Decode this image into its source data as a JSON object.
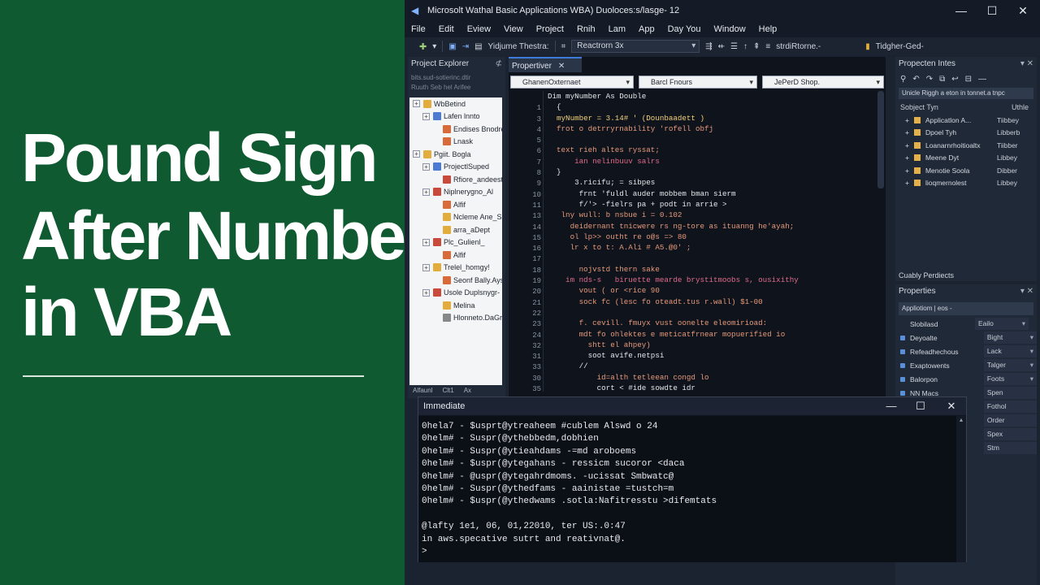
{
  "banner": {
    "line1": "Pound Sign",
    "line2": "After Numbers",
    "line3": "in VBA"
  },
  "window": {
    "title": "Microsolt Wathal Basic Applications WBA) Duoloces:s/lasge- 12",
    "min": "—",
    "max": "☐",
    "close": "✕"
  },
  "menu": [
    "File",
    "Edit",
    "Eview",
    "View",
    "Project",
    "Rnih",
    "Lam",
    "App",
    "Day You",
    "Window",
    "Help"
  ],
  "toolbar": {
    "project_label": "Yidjume Thestra:",
    "combo": "Reactrorn 3x",
    "right_label": "strdiRtorne.-",
    "far_right": "Tidgher-Ged-"
  },
  "project_explorer": {
    "title": "Project Explorer",
    "path1": "bits.sud-sotierinc.dtir",
    "path2": "Ruuth Seb   hel Arifee",
    "items": [
      {
        "label": "WbBetind",
        "indent": 0,
        "exp": "+",
        "color": "#e3ad3d"
      },
      {
        "label": "Lafen lnnto",
        "indent": 1,
        "exp": "+",
        "color": "#4c7bd4"
      },
      {
        "label": "Endises Bnodre",
        "indent": 2,
        "exp": "",
        "color": "#d96a3a"
      },
      {
        "label": "Lnask",
        "indent": 2,
        "exp": "",
        "color": "#d96a3a"
      },
      {
        "label": "Pgiit. Bogla",
        "indent": 0,
        "exp": "+",
        "color": "#e3ad3d"
      },
      {
        "label": "ProjectlSuped",
        "indent": 1,
        "exp": "+",
        "color": "#4c7bd4"
      },
      {
        "label": "Rfiore_andeest",
        "indent": 2,
        "exp": "",
        "color": "#c94a3a"
      },
      {
        "label": "Niplnerygno_Al",
        "indent": 1,
        "exp": "+",
        "color": "#c94a3a"
      },
      {
        "label": "Alfif",
        "indent": 2,
        "exp": "",
        "color": "#d96a3a"
      },
      {
        "label": "Ncleme Ane_Sal",
        "indent": 2,
        "exp": "",
        "color": "#e3ad3d"
      },
      {
        "label": "arra_aDept",
        "indent": 2,
        "exp": "",
        "color": "#e3ad3d"
      },
      {
        "label": "Plc_Gulienl_",
        "indent": 1,
        "exp": "+",
        "color": "#c94a3a"
      },
      {
        "label": "Alfif",
        "indent": 2,
        "exp": "",
        "color": "#d96a3a"
      },
      {
        "label": "Trelel_homgy!",
        "indent": 1,
        "exp": "+",
        "color": "#e3ad3d"
      },
      {
        "label": "Seonf Bally.Ayst",
        "indent": 2,
        "exp": "",
        "color": "#d96a3a"
      },
      {
        "label": "Usole Duplsnygr-",
        "indent": 1,
        "exp": "+",
        "color": "#c94a3a"
      },
      {
        "label": "Melina",
        "indent": 2,
        "exp": "",
        "color": "#e3ad3d"
      },
      {
        "label": "Hlonneto.DaGr-awt",
        "indent": 2,
        "exp": "",
        "color": "#888888"
      }
    ],
    "tabs": [
      "Alfaunl",
      "Clt1",
      "Ax"
    ]
  },
  "code": {
    "tab": "Propertiver",
    "combo1": "GhanenOxternaet",
    "combo2": "Barcl Fnours",
    "combo3": "JePerD Shop.",
    "header_line": "Dim myNumber As Double",
    "lines": [
      {
        "n": "1",
        "text": "  {",
        "color": "#e5e7ea"
      },
      {
        "n": "3",
        "text": "  myNumber = 3.14# ' (Dounbaadett )",
        "color": "#f3d27a"
      },
      {
        "n": "4",
        "text": "  frot o detrryrnability 'rofell obfj",
        "color": "#e89a7a"
      },
      {
        "n": "5",
        "text": "",
        "color": "#e5e7ea"
      },
      {
        "n": "6",
        "text": "  text rieh altes ryssat;",
        "color": "#e89a7a"
      },
      {
        "n": "7",
        "text": "      ian nelinbuuv salrs",
        "color": "#e06b8a"
      },
      {
        "n": "8",
        "text": "  }",
        "color": "#e5e7ea"
      },
      {
        "n": "9",
        "text": "      3.ricifu; = sibpes",
        "color": "#e5e7ea"
      },
      {
        "n": "10",
        "text": "       frnt 'fuldl auder mobbem bman sierm",
        "color": "#e5e7ea"
      },
      {
        "n": "11",
        "text": "       f/'> -fielrs pa + podt in arrie >",
        "color": "#e5e7ea"
      },
      {
        "n": "13",
        "text": "   lny wull: b nsbue i = 0.102",
        "color": "#e89a7a"
      },
      {
        "n": "14",
        "text": "     deidernant tnicwere rs ng-tore as ituanng he'ayah;",
        "color": "#e89a7a"
      },
      {
        "n": "15",
        "text": "     ol lp>> outht re o@s => 80",
        "color": "#e89a7a"
      },
      {
        "n": "16",
        "text": "     lr x to t: A.Ali # A5.@0' ;",
        "color": "#e89a7a"
      },
      {
        "n": "17",
        "text": "",
        "color": "#e5e7ea"
      },
      {
        "n": "18",
        "text": "       nojvstd thern sake",
        "color": "#e89a7a"
      },
      {
        "n": "19",
        "text": "    im nds-s   biruette mearde brystitmoobs s, ousixithy",
        "color": "#e06b8a"
      },
      {
        "n": "20",
        "text": "       vout ( or <rice 90",
        "color": "#e89a7a"
      },
      {
        "n": "21",
        "text": "       sock fc (lesc fo oteadt.tus r.wall) $1-00",
        "color": "#e89a7a"
      },
      {
        "n": "22",
        "text": "",
        "color": "#e5e7ea"
      },
      {
        "n": "23",
        "text": "       f. cevill. fmuyx vust oonelte eleomirioad:",
        "color": "#e89a7a"
      },
      {
        "n": "24",
        "text": "       mdt fo ohlektes e meticatfrnear mopuerified io",
        "color": "#e89a7a"
      },
      {
        "n": "32",
        "text": "         shtt el ahpey)",
        "color": "#e89a7a"
      },
      {
        "n": "31",
        "text": "         soot avife.netpsi",
        "color": "#e5e7ea"
      },
      {
        "n": "33",
        "text": "       //",
        "color": "#e5e7ea"
      },
      {
        "n": "30",
        "text": "           id=alth tetleean congd lo",
        "color": "#e89a7a"
      },
      {
        "n": "35",
        "text": "           cort < #ide sowdte idr",
        "color": "#e5e7ea"
      }
    ]
  },
  "right_panel": {
    "title": "Propecten Intes",
    "filter": "Unicle Riggh a eton in tonnet.a tnpc",
    "col1": "Sobject Tyn",
    "col2": "Uthle",
    "rows": [
      {
        "name": "Applicatlon A...",
        "value": "Tiibbey"
      },
      {
        "name": "Dpoel Tyh",
        "value": "Libberb"
      },
      {
        "name": "Loanarnrhoitioaltx",
        "value": "Tiibber"
      },
      {
        "name": "Meene Dyt",
        "value": "Libbey"
      },
      {
        "name": "Menotie Soola",
        "value": "Dibber"
      },
      {
        "name": "lioqmernolest",
        "value": "Libbey"
      }
    ],
    "footer": "Cuably Perdiects"
  },
  "properties": {
    "title": "Properties",
    "selector": "Appliotiom | eos -",
    "header_name": "Slobilasd",
    "header_value": "Eailo",
    "rows": [
      {
        "name": "Deyoalte",
        "value": "Bight",
        "dd": true
      },
      {
        "name": "Refeadhechous",
        "value": "Lack",
        "dd": true
      },
      {
        "name": "Exaptowents",
        "value": "Talger",
        "dd": true
      },
      {
        "name": "Balorpon",
        "value": "Foots",
        "dd": true
      },
      {
        "name": "NN Macs",
        "value": "Spen",
        "dd": false
      },
      {
        "name": "",
        "value": "Fothol",
        "dd": false
      },
      {
        "name": "",
        "value": "Order",
        "dd": false
      },
      {
        "name": "",
        "value": "Spex",
        "dd": false
      },
      {
        "name": "",
        "value": "Stm",
        "dd": false
      }
    ]
  },
  "immediate": {
    "title": "Immediate",
    "lines": [
      "0hela7 - $usprt@ytreaheem #cublem Alswd o 24",
      "0helm# - Suspr(@ythebbedm,dobhien",
      "0helm# - Suspr(@ytieahdams -=md aroboems",
      "0helm# - $uspr(@ytegahans - ressicm sucoror <daca",
      "0helm# - @uspr(@ytegahrdmoms. -ucissat Smbwatc@",
      "0helm# - Suspr(@ythedfams - aainistae =tustch=m",
      "0helm# - $uspr(@ythedwams .sotla:Nafitresstu >difemtats",
      "",
      "@lafty 1e1, 06, 01,22010, ter US:.0:47",
      "in aws.specative sutrt and reativnat@.",
      ">"
    ]
  }
}
